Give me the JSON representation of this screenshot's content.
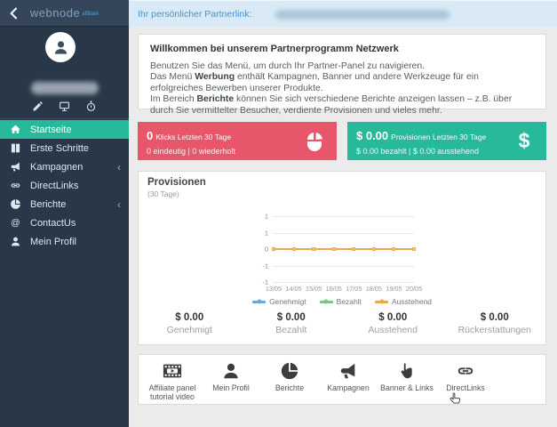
{
  "topbar": {
    "partner_link_label": "Ihr persönlicher Partnerlink:",
    "back_icon": "chevron-left-icon",
    "logo_text": "webnode",
    "logo_suffix": "affiliate"
  },
  "profile": {
    "avatar_icon": "user-icon",
    "action_icons": [
      "pencil-icon",
      "monitor-icon",
      "stopwatch-icon"
    ]
  },
  "sidebar": {
    "items": [
      {
        "label": "Startseite",
        "icon": "home",
        "active": true,
        "has_submenu": false
      },
      {
        "label": "Erste Schritte",
        "icon": "book",
        "active": false,
        "has_submenu": false
      },
      {
        "label": "Kampagnen",
        "icon": "megaphone",
        "active": false,
        "has_submenu": true
      },
      {
        "label": "DirectLinks",
        "icon": "links",
        "active": false,
        "has_submenu": false
      },
      {
        "label": "Berichte",
        "icon": "pie",
        "active": false,
        "has_submenu": true
      },
      {
        "label": "ContactUs",
        "icon": "at",
        "active": false,
        "has_submenu": false
      },
      {
        "label": "Mein Profil",
        "icon": "user",
        "active": false,
        "has_submenu": false
      }
    ]
  },
  "welcome": {
    "title": "Willkommen bei unserem Partnerprogramm Netzwerk",
    "lines": [
      [
        {
          "text": "Benutzen Sie das Menü, um durch Ihr Partner-Panel zu navigieren."
        }
      ],
      [
        {
          "text": "Das Menü "
        },
        {
          "text": "Werbung",
          "bold": true
        },
        {
          "text": " enthält Kampagnen, Banner und andere Werkzeuge für ein erfolgreiches Bewerben unserer Produkte."
        }
      ],
      [
        {
          "text": "Im Bereich "
        },
        {
          "text": "Berichte",
          "bold": true
        },
        {
          "text": " können Sie sich verschiedene Berichte anzeigen lassen – z.B. über durch Sie vermittelter Besucher, verdiente Provisionen und vieles mehr."
        }
      ]
    ]
  },
  "stat_cards": [
    {
      "value": "0",
      "label": "Klicks Letzten 30 Tage",
      "sub": "0 eindeutig | 0 wiederholt",
      "color": "#e7566b",
      "icon": "mouse-icon"
    },
    {
      "value": "$ 0.00",
      "label": "Provisionen Letzten 30 Tage",
      "sub": "$ 0.00 bezahlt | $ 0.00 ausstehend",
      "color": "#26b99a",
      "icon": "dollar-icon"
    }
  ],
  "chart_data": {
    "type": "line",
    "title": "Provisionen",
    "subtitle": "(30 Tage)",
    "x": [
      "13/05",
      "14/05",
      "15/05",
      "16/05",
      "17/05",
      "18/05",
      "19/05",
      "20/05"
    ],
    "y_tick_labels": [
      "1",
      "1",
      "0",
      "-1",
      "-1"
    ],
    "ylim": [
      -1,
      1
    ],
    "grid": true,
    "legend_position": "bottom",
    "series": [
      {
        "name": "Genehmigt",
        "color": "#6aa9d8",
        "values": [
          0,
          0,
          0,
          0,
          0,
          0,
          0,
          0
        ]
      },
      {
        "name": "Bezahlt",
        "color": "#7cc57e",
        "values": [
          0,
          0,
          0,
          0,
          0,
          0,
          0,
          0
        ]
      },
      {
        "name": "Ausstehend",
        "color": "#e8a94c",
        "values": [
          0,
          0,
          0,
          0,
          0,
          0,
          0,
          0
        ]
      }
    ],
    "visible_line_color": "#e8a94c",
    "marker_fill": "#f3cd8a"
  },
  "chart_stats": [
    {
      "value": "$ 0.00",
      "label": "Genehmigt"
    },
    {
      "value": "$ 0.00",
      "label": "Bezahlt"
    },
    {
      "value": "$ 0.00",
      "label": "Ausstehend"
    },
    {
      "value": "$ 0.00",
      "label": "Rückerstattungen"
    }
  ],
  "shortcuts": [
    {
      "label": "Affiliate panel tutorial video",
      "icon": "film"
    },
    {
      "label": "Mein Profil",
      "icon": "user"
    },
    {
      "label": "Berichte",
      "icon": "pie"
    },
    {
      "label": "Kampagnen",
      "icon": "megaphone"
    },
    {
      "label": "Banner & Links",
      "icon": "hand"
    },
    {
      "label": "DirectLinks",
      "icon": "links"
    }
  ],
  "cursor": {
    "icon": "hand-pointer-cursor",
    "near": "DirectLinks"
  },
  "colors": {
    "sidebar_bg": "#283848",
    "sidebar_header_bg": "#35465b",
    "active_item_bg": "#26b99a",
    "topbar_bg": "#d9eaf6",
    "topbar_text": "#4793c6",
    "content_bg": "#ebebeb",
    "card_red": "#e7566b",
    "card_green": "#26b99a"
  }
}
